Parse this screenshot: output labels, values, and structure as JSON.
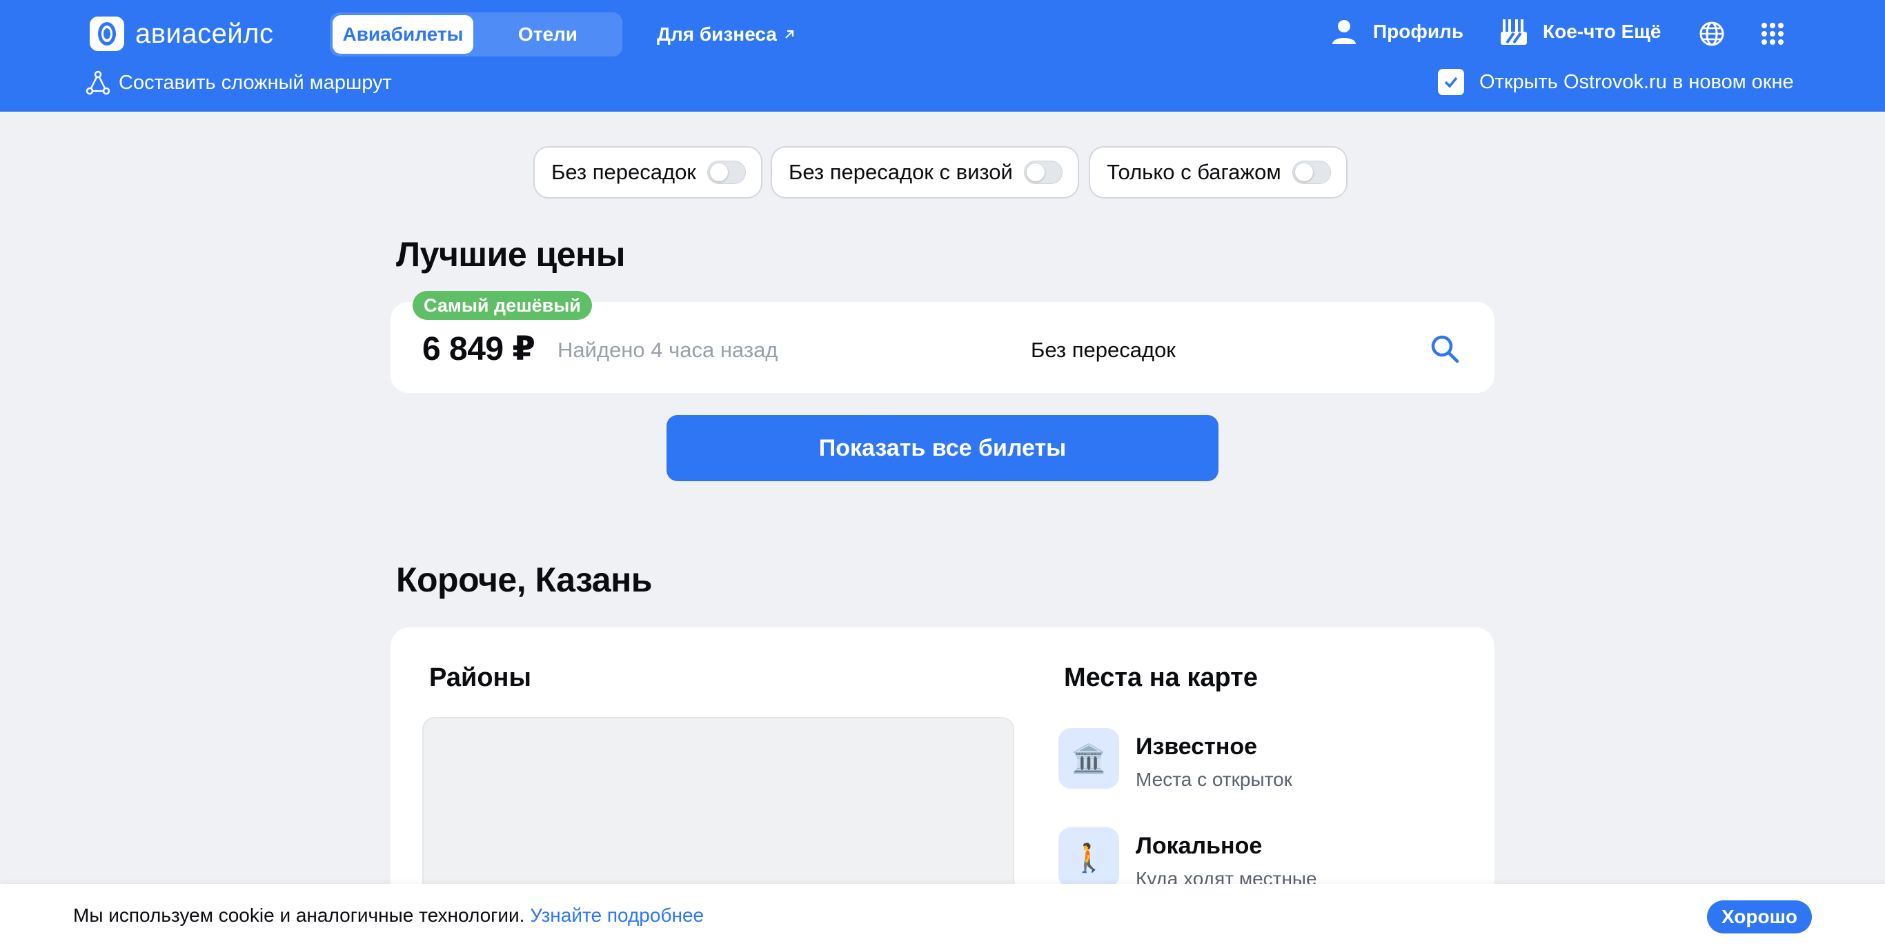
{
  "header": {
    "logo_text": "авиасейлс",
    "tabs": [
      {
        "label": "Авиабилеты",
        "active": true
      },
      {
        "label": "Отели",
        "active": false
      }
    ],
    "business_link": "Для бизнеса",
    "profile_label": "Профиль",
    "more_label": "Кое-что Ещё",
    "complex_route_label": "Составить сложный маршрут",
    "ostrovok_label": "Открыть Ostrovok.ru в новом окне",
    "ostrovok_checked": true
  },
  "filters": [
    {
      "label": "Без пересадок",
      "on": false
    },
    {
      "label": "Без пересадок с визой",
      "on": false
    },
    {
      "label": "Только с багажом",
      "on": false
    }
  ],
  "best_prices": {
    "title": "Лучшие цены",
    "badge": "Самый дешёвый",
    "price": "6 849 ₽",
    "found": "Найдено 4 часа назад",
    "transfers": "Без пересадок",
    "show_all_label": "Показать все билеты"
  },
  "city": {
    "title": "Короче, Казань",
    "districts_title": "Районы",
    "places_title": "Места на карте",
    "places": [
      {
        "title": "Известное",
        "subtitle": "Места с открыток",
        "icon": "🏛️"
      },
      {
        "title": "Локальное",
        "subtitle": "Куда ходят местные",
        "icon": "🚶"
      }
    ]
  },
  "cookie": {
    "text": "Мы используем cookie и аналогичные технологии.",
    "link": "Узнайте подробнее",
    "button": "Хорошо"
  },
  "colors": {
    "brand": "#2e76f3",
    "badge_green": "#5fbf66",
    "background": "#eff1f5"
  }
}
